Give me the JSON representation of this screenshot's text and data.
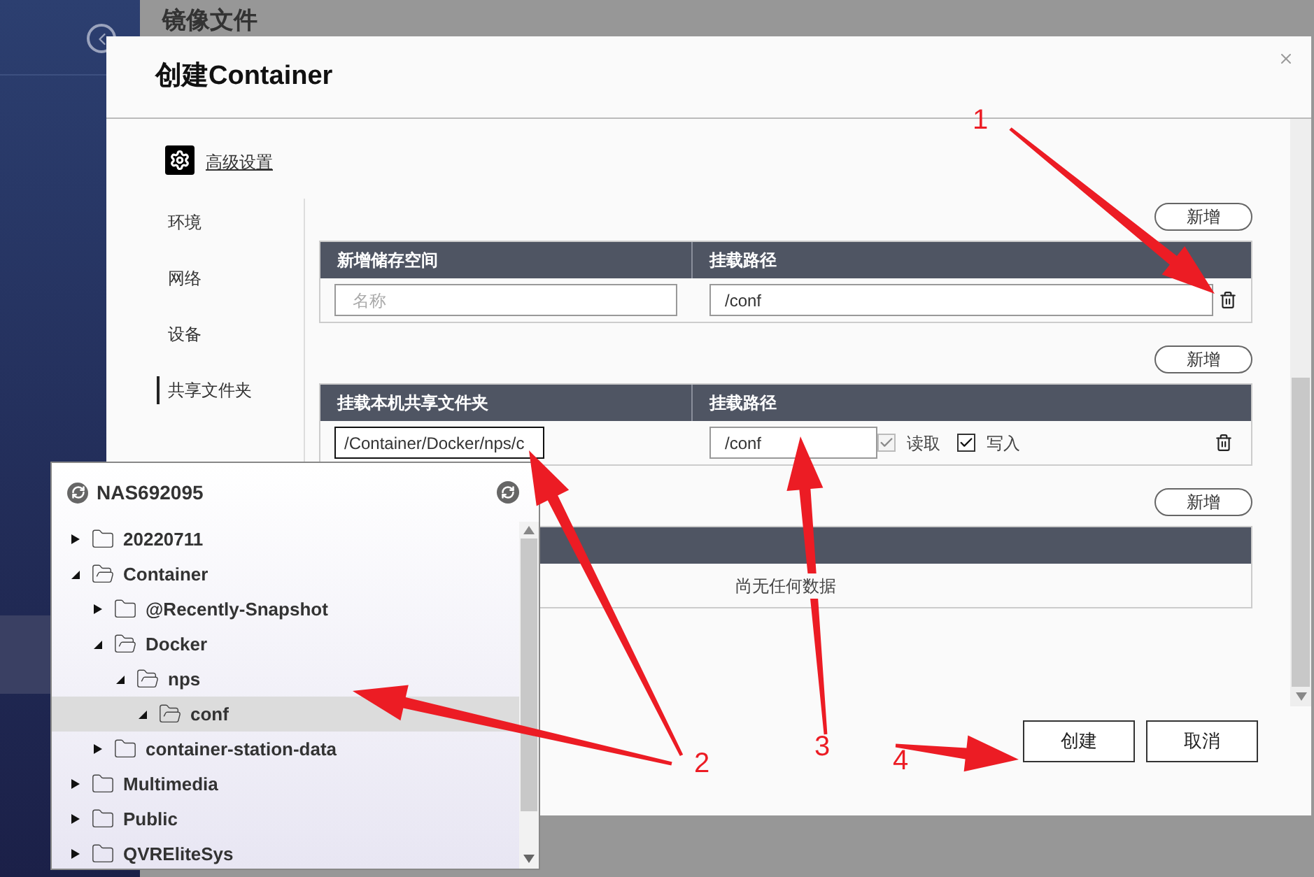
{
  "background": {
    "title": "镜像文件"
  },
  "dialog": {
    "title": "创建Container",
    "advanced_link": "高级设置",
    "nav": [
      {
        "label": "环境",
        "selected": false
      },
      {
        "label": "网络",
        "selected": false
      },
      {
        "label": "设备",
        "selected": false
      },
      {
        "label": "共享文件夹",
        "selected": true
      }
    ],
    "sections": [
      {
        "add_button": "新增",
        "columns": [
          "新增储存空间",
          "挂载路径"
        ],
        "rows": [
          {
            "kind": "volume",
            "name": {
              "placeholder": "名称"
            },
            "path": {
              "value": "/conf"
            }
          }
        ]
      },
      {
        "add_button": "新增",
        "columns": [
          "挂载本机共享文件夹",
          "挂载路径"
        ],
        "rows": [
          {
            "kind": "share",
            "folder": {
              "value": "/Container/Docker/nps/c",
              "focused": true
            },
            "path": {
              "value": "/conf"
            },
            "read": {
              "label": "读取",
              "checked": true,
              "disabled": true
            },
            "write": {
              "label": "写入",
              "checked": true,
              "disabled": false
            }
          }
        ]
      },
      {
        "add_button": "新增",
        "empty_text": "尚无任何数据"
      }
    ],
    "buttons": [
      "创建",
      "取消"
    ]
  },
  "folder_picker": {
    "root": "NAS692095",
    "tree": [
      {
        "label": "20220711",
        "expanded": false,
        "selected": false
      },
      {
        "label": "Container",
        "expanded": true,
        "selected": false,
        "children": [
          {
            "label": "@Recently-Snapshot",
            "expanded": false,
            "selected": false
          },
          {
            "label": "Docker",
            "expanded": true,
            "selected": false,
            "children": [
              {
                "label": "nps",
                "expanded": true,
                "selected": false,
                "children": [
                  {
                    "label": "conf",
                    "expanded": true,
                    "selected": true
                  }
                ]
              }
            ]
          },
          {
            "label": "container-station-data",
            "expanded": false,
            "selected": false
          }
        ]
      },
      {
        "label": "Multimedia",
        "expanded": false,
        "selected": false
      },
      {
        "label": "Public",
        "expanded": false,
        "selected": false
      },
      {
        "label": "QVREliteSys",
        "expanded": false,
        "selected": false
      }
    ]
  },
  "annotations": [
    {
      "label": "1"
    },
    {
      "label": "2"
    },
    {
      "label": "3"
    },
    {
      "label": "4"
    }
  ]
}
